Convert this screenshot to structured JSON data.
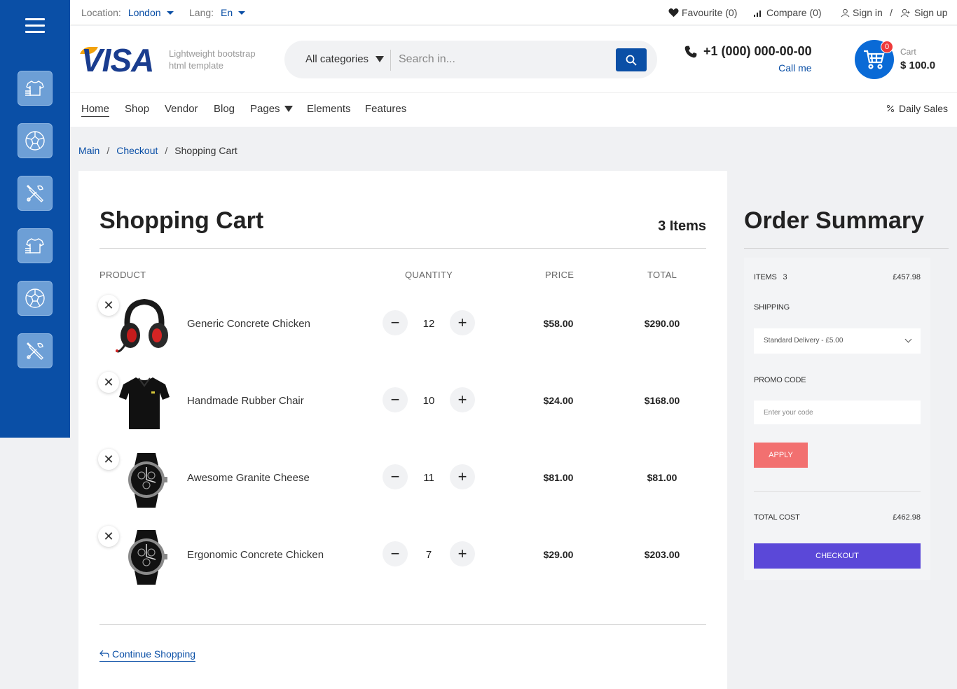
{
  "sidebar": {
    "items": [
      {
        "icon": "tshirt-icon"
      },
      {
        "icon": "soccer-ball-icon"
      },
      {
        "icon": "tools-icon"
      },
      {
        "icon": "tshirt-icon"
      },
      {
        "icon": "soccer-ball-icon"
      },
      {
        "icon": "tools-icon"
      }
    ]
  },
  "topbar": {
    "location_label": "Location:",
    "location_value": "London",
    "lang_label": "Lang:",
    "lang_value": "En",
    "favourite": "Favourite (0)",
    "compare": "Compare (0)",
    "sign_in": "Sign in",
    "separator": "/",
    "sign_up": "Sign up"
  },
  "header": {
    "logo": "VISA",
    "tagline_1": "Lightweight bootstrap",
    "tagline_2": "html template",
    "category": "All categories",
    "search_placeholder": "Search in...",
    "phone": "+1 (000) 000-00-00",
    "call_me": "Call me",
    "cart_badge": "0",
    "cart_label": "Cart",
    "cart_total": "$ 100.0"
  },
  "nav": {
    "items": [
      "Home",
      "Shop",
      "Vendor",
      "Blog",
      "Pages",
      "Elements",
      "Features"
    ],
    "daily_sales": "Daily Sales"
  },
  "breadcrumb": {
    "items": [
      "Main",
      "Checkout",
      "Shopping Cart"
    ],
    "separator": "/"
  },
  "cart": {
    "title": "Shopping Cart",
    "count": "3 Items",
    "headers": {
      "product": "PRODUCT",
      "quantity": "QUANTITY",
      "price": "PRICE",
      "total": "TOTAL"
    },
    "rows": [
      {
        "name": "Generic Concrete Chicken",
        "qty": "12",
        "price": "$58.00",
        "total": "$290.00",
        "image": "headset"
      },
      {
        "name": "Handmade Rubber Chair",
        "qty": "10",
        "price": "$24.00",
        "total": "$168.00",
        "image": "polo-shirt"
      },
      {
        "name": "Awesome Granite Cheese",
        "qty": "11",
        "price": "$81.00",
        "total": "$81.00",
        "image": "watch"
      },
      {
        "name": "Ergonomic Concrete Chicken",
        "qty": "7",
        "price": "$29.00",
        "total": "$203.00",
        "image": "watch"
      }
    ],
    "continue": "Continue Shopping"
  },
  "summary": {
    "title": "Order Summary",
    "items_label": "ITEMS",
    "items_count": "3",
    "items_value": "£457.98",
    "shipping_label": "SHIPPING",
    "shipping_option": "Standard Delivery - £5.00",
    "promo_label": "PROMO CODE",
    "promo_placeholder": "Enter your code",
    "apply": "APPLY",
    "total_label": "TOTAL COST",
    "total_value": "£462.98",
    "checkout": "CHECKOUT"
  },
  "colors": {
    "brand": "#0a4fa6",
    "apply": "#f27070",
    "checkout": "#5b48d8",
    "badge": "#ee3a3a"
  }
}
